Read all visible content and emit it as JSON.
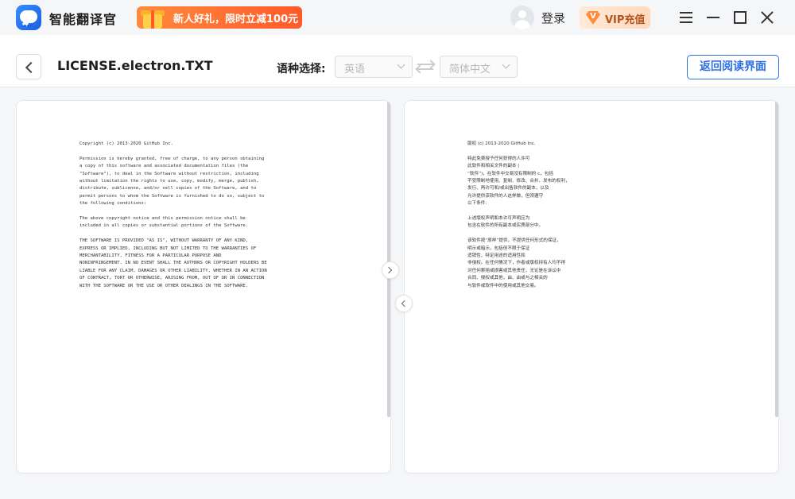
{
  "app": {
    "name": "智能翻译官",
    "promo_text": "新人好礼，限时立减",
    "promo_amount": "100元",
    "login_label": "登录",
    "vip_badge": "V",
    "vip_label": "VIP充值"
  },
  "toolbar": {
    "file_title": "LICENSE.electron.TXT",
    "lang_label": "语种选择:",
    "source_lang": "英语",
    "target_lang": "简体中文",
    "return_label": "返回阅读界面"
  },
  "source_doc": {
    "paragraphs": [
      "Copyright (c) 2013-2020 GitHub Inc.",
      "Permission is hereby granted, free of charge, to any person obtaining\na copy of this software and associated documentation files (the\n\"Software\"), to deal in the Software without restriction, including\nwithout limitation the rights to use, copy, modify, merge, publish,\ndistribute, sublicense, and/or sell copies of the Software, and to\npermit persons to whom the Software is furnished to do so, subject to\nthe following conditions:",
      "The above copyright notice and this permission notice shall be\nincluded in all copies or substantial portions of the Software.",
      "THE SOFTWARE IS PROVIDED \"AS IS\", WITHOUT WARRANTY OF ANY KIND,\nEXPRESS OR IMPLIED, INCLUDING BUT NOT LIMITED TO THE WARRANTIES OF\nMERCHANTABILITY, FITNESS FOR A PARTICULAR PURPOSE AND\nNONINFRINGEMENT. IN NO EVENT SHALL THE AUTHORS OR COPYRIGHT HOLDERS BE\nLIABLE FOR ANY CLAIM, DAMAGES OR OTHER LIABILITY, WHETHER IN AN ACTION\nOF CONTRACT, TORT OR OTHERWISE, ARISING FROM, OUT OF OR IN CONNECTION\nWITH THE SOFTWARE OR THE USE OR OTHER DEALINGS IN THE SOFTWARE."
    ]
  },
  "translated_doc": {
    "paragraphs": [
      "版权 (c) 2013-2020 GitHub Inc.",
      "特此免费授予任何获得的人许可\n此软件和相关文件的副本 (\n“软件”)，在软件中交易没有限制的 c，包括\n不受限制地使用、复制、修改、合并、发布的权利，\n发行、再许可和/或出售软件的副本，以及\n允许提供该软件的人这样做，但须遵守\n以下条件:",
      "上述版权声明和本许可声明应为\n包含在软件的所有副本或实质部分中。",
      "该软件按“原样”提供，不提供任何形式的保证，\n明示或暗示，包括但不限于保证\n适销性、特定用途的适用性和\n非侵权。在任何情况下，作者或版权持有人均不得\n对任何索赔或损害或其他责任，无论是在诉讼中\n合同、侵权或其他，由、由或与之相关的\n与软件或软件中的使用或其他交易。"
    ]
  }
}
